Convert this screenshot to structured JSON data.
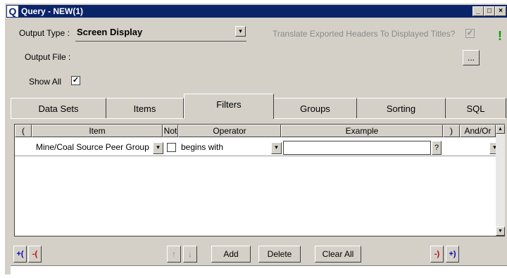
{
  "window": {
    "icon_letter": "Q",
    "title": "Query - NEW(1)",
    "minimize": "_",
    "maximize": "□",
    "close": "×"
  },
  "form": {
    "output_type_label": "Output Type :",
    "output_type_value": "Screen Display",
    "translate_label": "Translate Exported Headers To Displayed Titles?",
    "translate_checked": "✓",
    "output_file_label": "Output File :",
    "browse_label": "...",
    "run_label": "!",
    "show_all_label": "Show All",
    "show_all_checked": "✓"
  },
  "tabs": [
    {
      "label": "Data Sets"
    },
    {
      "label": "Items"
    },
    {
      "label": "Filters"
    },
    {
      "label": "Groups"
    },
    {
      "label": "Sorting"
    },
    {
      "label": "SQL"
    }
  ],
  "active_tab": "Filters",
  "grid": {
    "columns": [
      "(",
      "Item",
      "Not",
      "Operator",
      "Example",
      ")",
      "And/Or"
    ],
    "rows": [
      {
        "open_paren": "",
        "item": "Mine/Coal Source Peer Group",
        "not": "",
        "operator": "begins with",
        "example": "",
        "close_paren": "",
        "and_or": ""
      }
    ],
    "example_help": "?"
  },
  "toolbar": {
    "add_open_paren": "+(",
    "remove_open_paren": "-(",
    "move_up": "↑",
    "move_down": "↓",
    "add": "Add",
    "delete": "Delete",
    "clear_all": "Clear All",
    "remove_close_paren": "-)",
    "add_close_paren": "+)"
  }
}
